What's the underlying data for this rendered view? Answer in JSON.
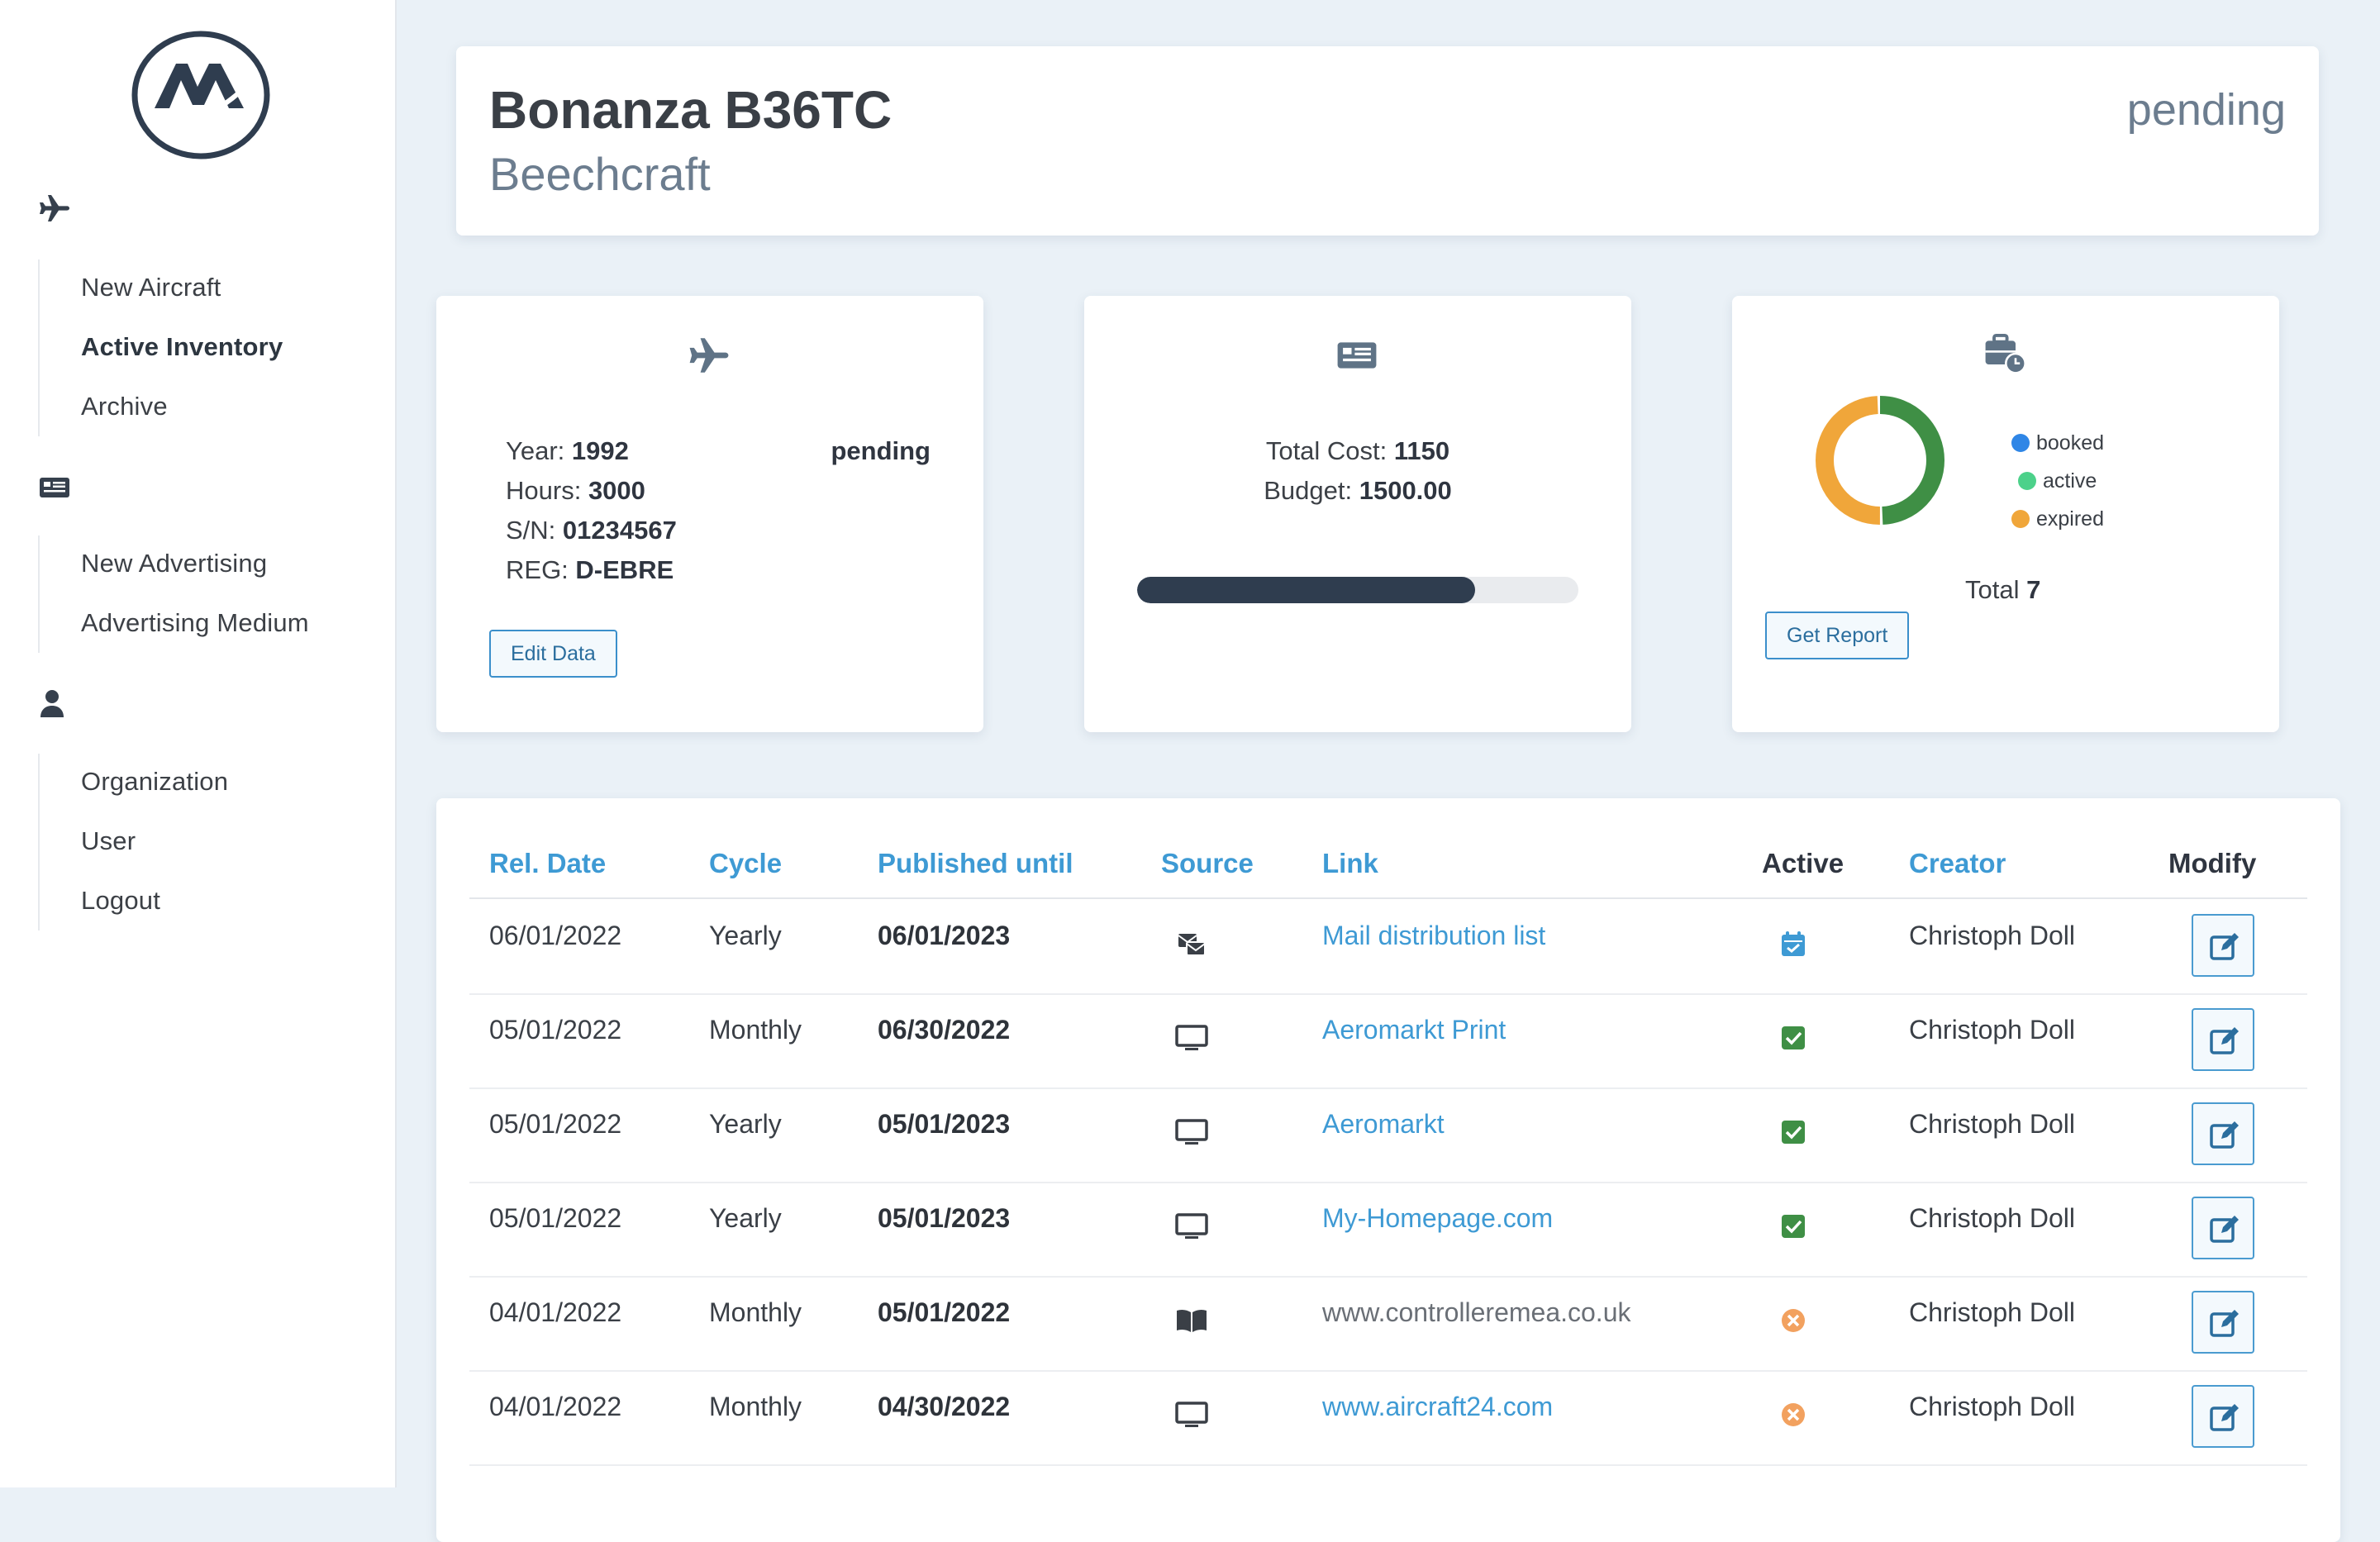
{
  "sidebar": {
    "sections": [
      {
        "icon": "airplane-icon",
        "items": [
          {
            "label": "New Aircraft",
            "active": false
          },
          {
            "label": "Active Inventory",
            "active": true
          },
          {
            "label": "Archive",
            "active": false
          }
        ]
      },
      {
        "icon": "newspaper-icon",
        "items": [
          {
            "label": "New Advertising",
            "active": false
          },
          {
            "label": "Advertising Medium",
            "active": false
          }
        ]
      },
      {
        "icon": "user-icon",
        "items": [
          {
            "label": "Organization",
            "active": false
          },
          {
            "label": "User",
            "active": false
          },
          {
            "label": "Logout",
            "active": false
          }
        ]
      }
    ]
  },
  "header": {
    "title": "Bonanza B36TC",
    "manufacturer": "Beechcraft",
    "status": "pending"
  },
  "aircraft_card": {
    "icon": "airplane-icon",
    "year_label": "Year:",
    "year": "1992",
    "hours_label": "Hours:",
    "hours": "3000",
    "sn_label": "S/N:",
    "sn": "01234567",
    "reg_label": "REG:",
    "reg": "D-EBRE",
    "status": "pending",
    "edit_button": "Edit Data"
  },
  "cost_card": {
    "icon": "newspaper-icon",
    "total_cost_label": "Total Cost:",
    "total_cost": "1150",
    "budget_label": "Budget:",
    "budget": "1500.00",
    "progress": 0.7667
  },
  "report_card": {
    "icon": "briefcase-clock-icon",
    "legend": [
      {
        "label": "booked",
        "color": "#2f86e6"
      },
      {
        "label": "active",
        "color": "#4cd18a"
      },
      {
        "label": "expired",
        "color": "#f0a63a"
      }
    ],
    "donut": [
      {
        "label": "active",
        "value": 0.5,
        "color": "#3f8f45"
      },
      {
        "label": "expired",
        "value": 0.5,
        "color": "#f0a63a"
      }
    ],
    "total_label": "Total",
    "total": "7",
    "report_button": "Get Report"
  },
  "table": {
    "columns": [
      "Rel. Date",
      "Cycle",
      "Published until",
      "Source",
      "Link",
      "Active",
      "Creator",
      "Modify"
    ],
    "rows": [
      {
        "rel_date": "06/01/2022",
        "cycle": "Yearly",
        "published_until": "06/01/2023",
        "source": "mail-list-icon",
        "link": "Mail distribution list",
        "link_active": true,
        "active": "calendar-check-icon",
        "creator": "Christoph Doll"
      },
      {
        "rel_date": "05/01/2022",
        "cycle": "Monthly",
        "published_until": "06/30/2022",
        "source": "monitor-icon",
        "link": "Aeromarkt Print",
        "link_active": true,
        "active": "check-icon",
        "creator": "Christoph Doll"
      },
      {
        "rel_date": "05/01/2022",
        "cycle": "Yearly",
        "published_until": "05/01/2023",
        "source": "monitor-icon",
        "link": "Aeromarkt",
        "link_active": true,
        "active": "check-icon",
        "creator": "Christoph Doll"
      },
      {
        "rel_date": "05/01/2022",
        "cycle": "Yearly",
        "published_until": "05/01/2023",
        "source": "monitor-icon",
        "link": "My-Homepage.com",
        "link_active": true,
        "active": "check-icon",
        "creator": "Christoph Doll"
      },
      {
        "rel_date": "04/01/2022",
        "cycle": "Monthly",
        "published_until": "05/01/2022",
        "source": "book-icon",
        "link": "www.controlleremea.co.uk",
        "link_active": false,
        "active": "expired-x-icon",
        "creator": "Christoph Doll"
      },
      {
        "rel_date": "04/01/2022",
        "cycle": "Monthly",
        "published_until": "04/30/2022",
        "source": "monitor-icon",
        "link": "www.aircraft24.com",
        "link_active": true,
        "active": "expired-x-icon",
        "creator": "Christoph Doll"
      }
    ]
  },
  "colors": {
    "accent": "#3e9ad4",
    "dark": "#2f3d4f",
    "success": "#3f8f45",
    "warning": "#f0a63a"
  }
}
